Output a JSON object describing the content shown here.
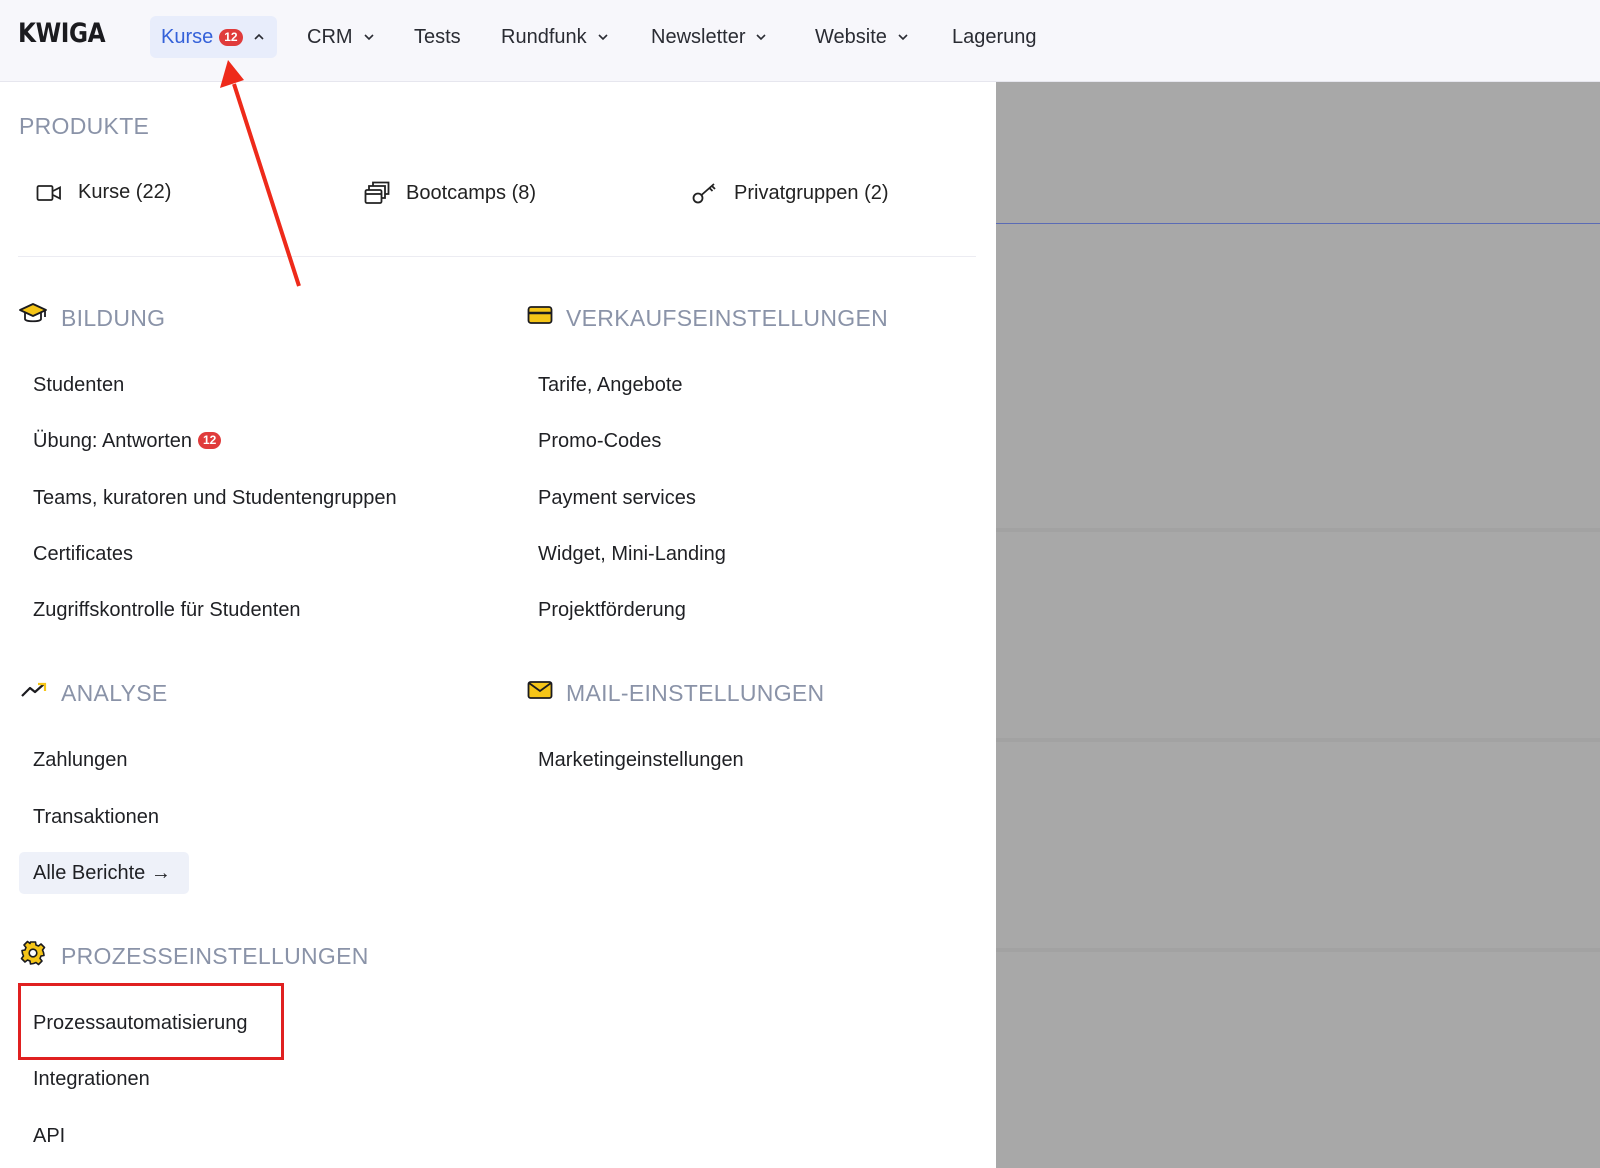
{
  "header": {
    "logo": "KWIGA",
    "nav": [
      {
        "label": "Kurse",
        "badge": "12",
        "chevron": "chevron-up-icon"
      },
      {
        "label": "CRM",
        "chevron": "chevron-down-icon"
      },
      {
        "label": "Tests"
      },
      {
        "label": "Rundfunk",
        "chevron": "chevron-down-icon"
      },
      {
        "label": "Newsletter",
        "chevron": "chevron-down-icon"
      },
      {
        "label": "Website",
        "chevron": "chevron-down-icon"
      },
      {
        "label": "Lagerung"
      }
    ]
  },
  "menu": {
    "products": {
      "title": "PRODUKTE",
      "items": [
        {
          "label": "Kurse (22)",
          "icon": "video-icon"
        },
        {
          "label": "Bootcamps (8)",
          "icon": "stacked-cards-icon"
        },
        {
          "label": "Privatgruppen (2)",
          "icon": "key-icon"
        }
      ]
    },
    "bildung": {
      "title": "BILDUNG",
      "icon": "graduation-cap-icon",
      "items": [
        {
          "label": "Studenten"
        },
        {
          "label": "Übung: Antworten",
          "badge": "12"
        },
        {
          "label": "Teams, kuratoren und Studentengruppen"
        },
        {
          "label": "Certificates"
        },
        {
          "label": "Zugriffskontrolle für Studenten"
        }
      ]
    },
    "verkauf": {
      "title": "VERKAUFSEINSTELLUNGEN",
      "icon": "credit-card-icon",
      "items": [
        {
          "label": "Tarife, Angebote"
        },
        {
          "label": "Promo-Codes"
        },
        {
          "label": "Payment services"
        },
        {
          "label": "Widget, Mini-Landing"
        },
        {
          "label": "Projektförderung"
        }
      ]
    },
    "analyse": {
      "title": "ANALYSE",
      "icon": "trending-up-icon",
      "items": [
        {
          "label": "Zahlungen"
        },
        {
          "label": "Transaktionen"
        }
      ],
      "all_reports": "Alle Berichte →"
    },
    "mail": {
      "title": "MAIL-EINSTELLUNGEN",
      "icon": "envelope-icon",
      "items": [
        {
          "label": "Marketingeinstellungen"
        }
      ]
    },
    "prozess": {
      "title": "PROZESSEINSTELLUNGEN",
      "icon": "gear-icon",
      "items": [
        {
          "label": "Prozessautomatisierung",
          "highlighted": true
        },
        {
          "label": "Integrationen"
        },
        {
          "label": "API"
        }
      ]
    }
  },
  "colors": {
    "accent": "#3461d9",
    "badge": "#e03b3b",
    "icon_yellow": "#f5c518",
    "annotation_red": "#e02020",
    "overlay": "#a8a8a8"
  }
}
